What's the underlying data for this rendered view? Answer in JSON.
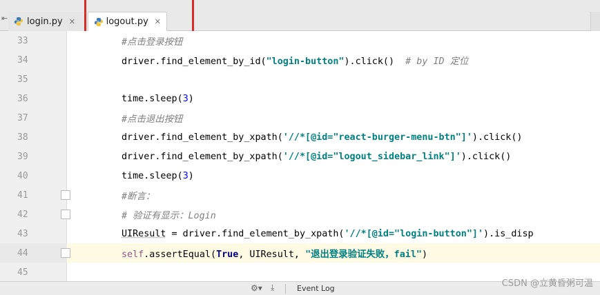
{
  "tabs": [
    {
      "label": "login.py",
      "active": false
    },
    {
      "label": "logout.py",
      "active": true
    }
  ],
  "lines": [
    {
      "num": "33",
      "segments": [
        {
          "t": "#点击登录按钮",
          "c": "c-comment"
        }
      ]
    },
    {
      "num": "34",
      "segments": [
        {
          "t": "driver.find_element_by_id(",
          "c": ""
        },
        {
          "t": "\"login-button\"",
          "c": "c-string"
        },
        {
          "t": ").click()  ",
          "c": ""
        },
        {
          "t": "# by ID 定位",
          "c": "c-comment"
        }
      ]
    },
    {
      "num": "35",
      "segments": []
    },
    {
      "num": "36",
      "segments": [
        {
          "t": "time.sleep(",
          "c": ""
        },
        {
          "t": "3",
          "c": "c-num"
        },
        {
          "t": ")",
          "c": ""
        }
      ]
    },
    {
      "num": "37",
      "segments": [
        {
          "t": "#点击退出按钮",
          "c": "c-comment"
        }
      ]
    },
    {
      "num": "38",
      "segments": [
        {
          "t": "driver.find_element_by_xpath(",
          "c": ""
        },
        {
          "t": "'//*[@id=\"react-burger-menu-btn\"]'",
          "c": "c-string"
        },
        {
          "t": ").click()",
          "c": ""
        }
      ]
    },
    {
      "num": "39",
      "segments": [
        {
          "t": "driver.find_element_by_xpath(",
          "c": ""
        },
        {
          "t": "'//*[@id=\"logout_sidebar_link\"]'",
          "c": "c-string"
        },
        {
          "t": ").click()",
          "c": ""
        }
      ]
    },
    {
      "num": "40",
      "segments": [
        {
          "t": "time.sleep(",
          "c": ""
        },
        {
          "t": "3",
          "c": "c-num"
        },
        {
          "t": ")",
          "c": ""
        }
      ]
    },
    {
      "num": "41",
      "segments": [
        {
          "t": "#断言：",
          "c": "c-comment"
        }
      ]
    },
    {
      "num": "42",
      "segments": [
        {
          "t": "# 验证有显示：Login",
          "c": "c-comment"
        }
      ]
    },
    {
      "num": "43",
      "segments": [
        {
          "t": "UIResult",
          "c": "squiggle"
        },
        {
          "t": " = driver.find_element_by_xpath(",
          "c": ""
        },
        {
          "t": "'//*[@id=\"login-button\"]'",
          "c": "c-string"
        },
        {
          "t": ").is_disp",
          "c": ""
        }
      ]
    },
    {
      "num": "44",
      "segments": [
        {
          "t": "self",
          "c": "c-self"
        },
        {
          "t": ".assertEqual(",
          "c": ""
        },
        {
          "t": "True",
          "c": "c-kw"
        },
        {
          "t": ", UIResult, ",
          "c": ""
        },
        {
          "t": "\"退出登录验证失败，fail\"",
          "c": "c-string"
        },
        {
          "t": ")",
          "c": ""
        }
      ]
    },
    {
      "num": "45",
      "segments": []
    }
  ],
  "current_line": "44",
  "fold_markers": [
    "41",
    "42",
    "44"
  ],
  "statusbar": {
    "gear_icon": "gear-icon",
    "event_log": "Event Log"
  },
  "watermark": "CSDN @立黄昏粥可温",
  "colors": {
    "highlight": "#d62b26",
    "current_line": "#fffae3"
  }
}
